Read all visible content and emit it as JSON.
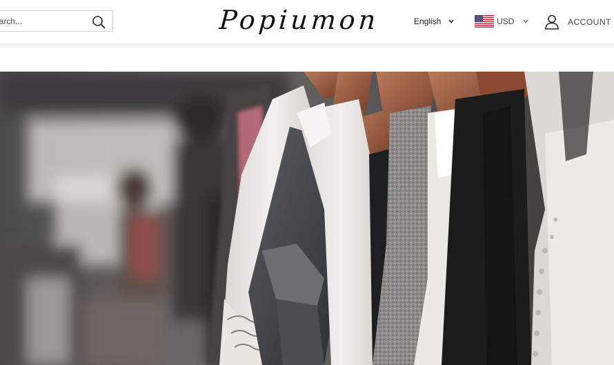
{
  "header": {
    "search": {
      "placeholder": "Search..."
    },
    "logo_text": "Popiumon",
    "language": {
      "selected": "English"
    },
    "currency": {
      "selected": "USD",
      "flag": "us-flag-icon"
    },
    "account_label": "ACCOUNT"
  },
  "hero": {
    "image": "clothing-rack-photo"
  },
  "colors": {
    "text": "#222222",
    "border": "#cfcfcf"
  }
}
